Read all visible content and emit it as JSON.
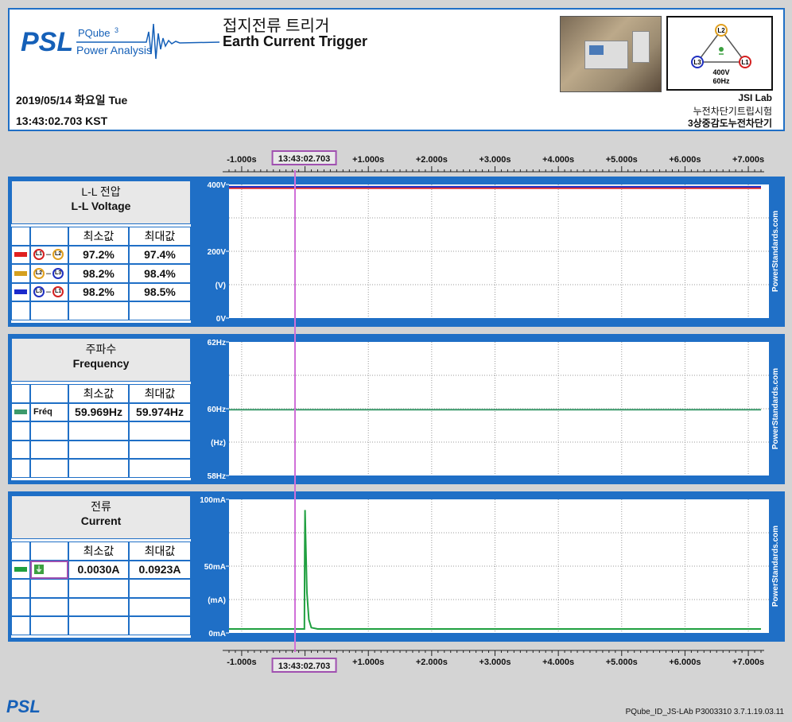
{
  "header": {
    "logo": "PSL",
    "product_name": "PQube",
    "product_version": "3",
    "product_sub": "Power Analysis",
    "title_ko": "접지전류 트리거",
    "title_en": "Earth Current Trigger",
    "date": "2019/05/14 화요일 Tue",
    "time": "13:43:02.703 KST",
    "site_name": "JSI Lab",
    "site_line2": "누전차단기트립시험",
    "site_line3": "3상중감도누전차단기",
    "diagram": {
      "voltage": "400V",
      "freq": "60Hz",
      "l1": "L1",
      "l2": "L2",
      "l3": "L3"
    }
  },
  "time_axis": {
    "cursor_label": "13:43:02.703",
    "ticks": [
      "-1.000s",
      "+1.000s",
      "+2.000s",
      "+3.000s",
      "+4.000s",
      "+5.000s",
      "+6.000s",
      "+7.000s"
    ]
  },
  "watermark": "PowerStandards.com",
  "panels": [
    {
      "title_ko": "L-L 전압",
      "title_en": "L-L Voltage",
      "min_label": "최소값",
      "max_label": "최대값",
      "rows": [
        {
          "color": "#e02020",
          "a": "L1",
          "a_color": "#d42020",
          "b": "L2",
          "b_color": "#e0a020",
          "min": "97.2%",
          "max": "97.4%"
        },
        {
          "color": "#d4a020",
          "a": "L2",
          "a_color": "#e0a020",
          "b": "L3",
          "b_color": "#2030c0",
          "min": "98.2%",
          "max": "98.4%"
        },
        {
          "color": "#1a2acc",
          "a": "L3",
          "a_color": "#2030c0",
          "b": "L1",
          "b_color": "#d42020",
          "min": "98.2%",
          "max": "98.5%"
        }
      ],
      "yticks": [
        "400V",
        "200V",
        "(V)",
        "0V"
      ]
    },
    {
      "title_ko": "주파수",
      "title_en": "Frequency",
      "min_label": "최소값",
      "max_label": "최대값",
      "rows": [
        {
          "color": "#3c9a6c",
          "name": "Fréq",
          "min": "59.969Hz",
          "max": "59.974Hz"
        }
      ],
      "yticks": [
        "62Hz",
        "60Hz",
        "(Hz)",
        "58Hz"
      ]
    },
    {
      "title_ko": "전류",
      "title_en": "Current",
      "min_label": "최소값",
      "max_label": "최대값",
      "rows": [
        {
          "color": "#20a040",
          "name": "earth-icon",
          "min": "0.0030A",
          "max": "0.0923A"
        }
      ],
      "yticks": [
        "100mA",
        "50mA",
        "(mA)",
        "0mA"
      ]
    }
  ],
  "footer": {
    "logo": "PSL",
    "info": "PQube_ID_JS-LAb  P3003310  3.7.1.19.03.11"
  },
  "chart_data": [
    {
      "type": "line",
      "xlim": [
        -1.2,
        7.2
      ],
      "ylim": [
        0,
        400
      ],
      "series": [
        {
          "color": "#e02020",
          "x": [
            -1.2,
            7.2
          ],
          "y": [
            389,
            389
          ]
        },
        {
          "color": "#d4a020",
          "x": [
            -1.2,
            7.2
          ],
          "y": [
            393,
            393
          ]
        },
        {
          "color": "#1a2acc",
          "x": [
            -1.2,
            7.2
          ],
          "y": [
            393,
            393
          ]
        }
      ]
    },
    {
      "type": "line",
      "xlim": [
        -1.2,
        7.2
      ],
      "ylim": [
        58,
        62
      ],
      "series": [
        {
          "color": "#3c9a6c",
          "x": [
            -1.2,
            7.2
          ],
          "y": [
            59.97,
            59.97
          ]
        }
      ]
    },
    {
      "type": "line",
      "xlim": [
        -1.2,
        7.2
      ],
      "ylim": [
        0,
        100
      ],
      "series": [
        {
          "color": "#20a040",
          "x": [
            -1.2,
            -0.01,
            -0.005,
            0.0,
            0.01,
            0.03,
            0.06,
            0.1,
            0.2,
            7.2
          ],
          "y": [
            3,
            3,
            60,
            92,
            70,
            30,
            10,
            4,
            3,
            3
          ]
        }
      ]
    }
  ]
}
